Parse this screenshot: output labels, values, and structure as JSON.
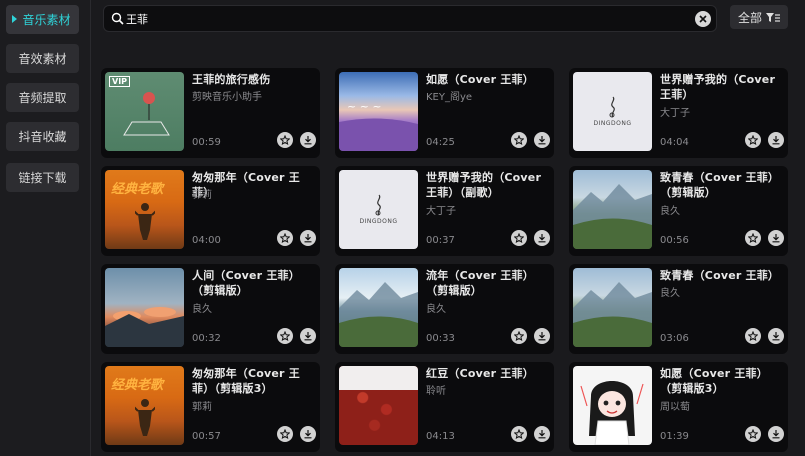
{
  "sidebar": {
    "items": [
      {
        "label": "音乐素材",
        "active": true
      },
      {
        "label": "音效素材",
        "active": false
      },
      {
        "label": "音频提取",
        "active": false
      },
      {
        "label": "抖音收藏",
        "active": false
      },
      {
        "label": "链接下载",
        "active": false
      }
    ]
  },
  "search": {
    "value": "王菲",
    "icon": "search-icon",
    "clear_icon": "close-icon"
  },
  "filter": {
    "label": "全部",
    "icon": "filter-icon"
  },
  "colors": {
    "accent": "#2fd3d8",
    "background": "#1a1a1d",
    "card": "#0b0b0d"
  },
  "cards": [
    {
      "title": "王菲的旅行感伤",
      "artist": "剪映音乐小助手",
      "duration": "00:59",
      "thumb": "vip",
      "badge": "VIP"
    },
    {
      "title": "如愿（Cover 王菲）",
      "artist": "KEY_阁ye",
      "duration": "04:25",
      "thumb": "lavender"
    },
    {
      "title": "世界赠予我的（Cover 王菲）",
      "artist": "大丁子",
      "duration": "04:04",
      "thumb": "wechat",
      "logo_text": "DINGDONG"
    },
    {
      "title": "匆匆那年（Cover 王菲）",
      "artist": "郭莉",
      "duration": "04:00",
      "thumb": "orange",
      "banner": "经典老歌"
    },
    {
      "title": "世界赠予我的（Cover 王菲）（副歌）",
      "artist": "大丁子",
      "duration": "00:37",
      "thumb": "wechat",
      "logo_text": "DINGDONG"
    },
    {
      "title": "致青春（Cover 王菲）（剪辑版）",
      "artist": "良久",
      "duration": "00:56",
      "thumb": "mount"
    },
    {
      "title": "人间（Cover 王菲）（剪辑版）",
      "artist": "良久",
      "duration": "00:32",
      "thumb": "sunset"
    },
    {
      "title": "流年（Cover 王菲）（剪辑版）",
      "artist": "良久",
      "duration": "00:33",
      "thumb": "lake"
    },
    {
      "title": "致青春（Cover 王菲）",
      "artist": "良久",
      "duration": "03:06",
      "thumb": "mount"
    },
    {
      "title": "匆匆那年（Cover 王菲）（剪辑版3）",
      "artist": "郭莉",
      "duration": "00:57",
      "thumb": "orange",
      "banner": "经典老歌"
    },
    {
      "title": "红豆（Cover 王菲）",
      "artist": "聆听",
      "duration": "04:13",
      "thumb": "beans"
    },
    {
      "title": "如愿（Cover 王菲）（剪辑版3）",
      "artist": "周以萄",
      "duration": "01:39",
      "thumb": "anime"
    }
  ],
  "card_icons": {
    "favorite": "star-icon",
    "download": "download-icon"
  }
}
